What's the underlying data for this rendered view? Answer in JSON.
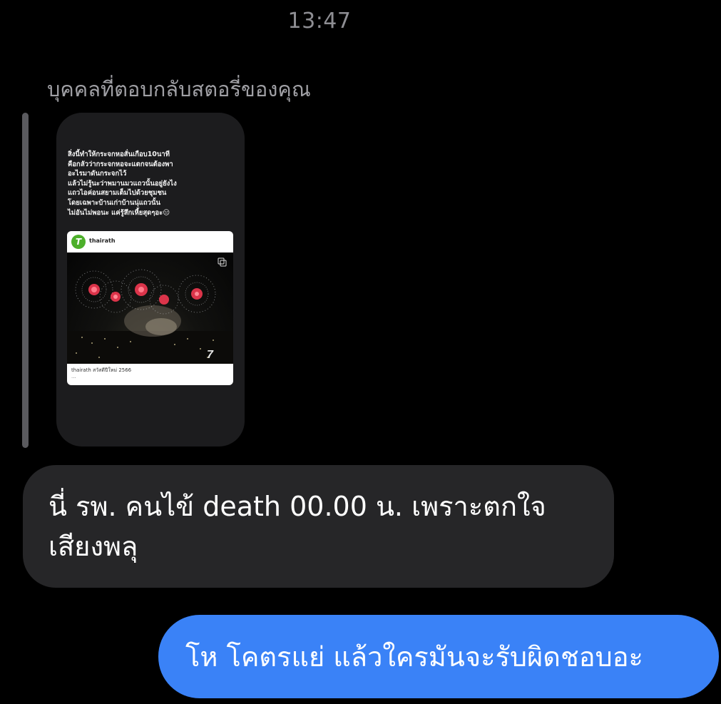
{
  "chat": {
    "timestamp": "13:47",
    "reply_caption": "บุคคลที่ตอบกลับสตอรี่ของคุณ",
    "story": {
      "text": "สิ่งนี้ทำให้กระจกหอสั่นเกือบ10นาที\nคือกลัวว่ากระจกหอจะแตกจนต้องพา\nอะไรมาดันกระจกไว้\nแล้วไม่รู้นะว่าพมานมวแถวนั้นอยู่ยังไง\nแถวไอค่อนสยามเต็มไปด้วยชุมชน\nโดยเฉพาะบ้านเก่าบ้านนุ่แถวนั้น\nไม่อันไม่พอนะ แค่รู้สึกเหี้ยสุดๆอะ😑",
      "post": {
        "avatar_letter": "T",
        "username": "thairath",
        "caption": "thairath สวัสดีปีใหม่ 2566",
        "caption_more": "..."
      }
    },
    "incoming_message": "นี่ รพ. คนไข้ death 00.00 น. เพราะตกใจเสียงพลุ",
    "outgoing_message": "โห โคตรแย่ แล้วใครมันจะรับผิดชอบอะ"
  },
  "colors": {
    "background": "#000000",
    "incoming_bubble": "#262628",
    "outgoing_bubble": "#3a82f7",
    "secondary_text": "#8e8e93",
    "firework_red": "#ff3b55"
  }
}
